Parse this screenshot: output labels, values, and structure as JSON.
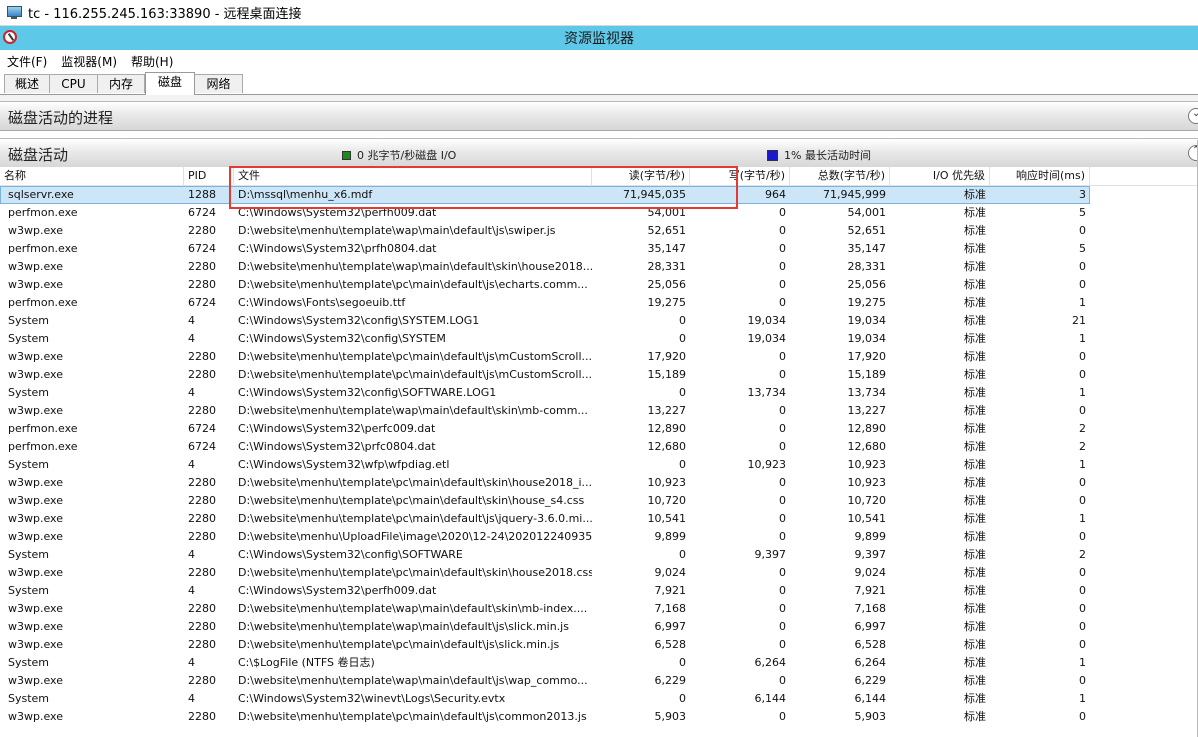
{
  "rdp": {
    "title": "tc - 116.255.245.163:33890 - 远程桌面连接"
  },
  "app": {
    "title": "资源监视器"
  },
  "menu": [
    "文件(F)",
    "监视器(M)",
    "帮助(H)"
  ],
  "tabs": [
    "概述",
    "CPU",
    "内存",
    "磁盘",
    "网络"
  ],
  "active_tab": "磁盘",
  "sections": {
    "processes": "磁盘活动的进程",
    "activity": "磁盘活动",
    "legend_io": "0 兆字节/秒磁盘 I/O",
    "legend_active": "1% 最长活动时间",
    "legend_io_color": "#1a8a1a",
    "legend_active_color": "#1a1acc"
  },
  "columns": [
    "名称",
    "PID",
    "文件",
    "读(字节/秒)",
    "写(字节/秒)",
    "总数(字节/秒)",
    "I/O 优先级",
    "响应时间(ms)"
  ],
  "rows": [
    [
      "sqlservr.exe",
      "1288",
      "D:\\mssql\\menhu_x6.mdf",
      "71,945,035",
      "964",
      "71,945,999",
      "标准",
      "3"
    ],
    [
      "perfmon.exe",
      "6724",
      "C:\\Windows\\System32\\perfh009.dat",
      "54,001",
      "0",
      "54,001",
      "标准",
      "5"
    ],
    [
      "w3wp.exe",
      "2280",
      "D:\\website\\menhu\\template\\wap\\main\\default\\js\\swiper.js",
      "52,651",
      "0",
      "52,651",
      "标准",
      "0"
    ],
    [
      "perfmon.exe",
      "6724",
      "C:\\Windows\\System32\\prfh0804.dat",
      "35,147",
      "0",
      "35,147",
      "标准",
      "5"
    ],
    [
      "w3wp.exe",
      "2280",
      "D:\\website\\menhu\\template\\wap\\main\\default\\skin\\house2018...",
      "28,331",
      "0",
      "28,331",
      "标准",
      "0"
    ],
    [
      "w3wp.exe",
      "2280",
      "D:\\website\\menhu\\template\\pc\\main\\default\\js\\echarts.comm...",
      "25,056",
      "0",
      "25,056",
      "标准",
      "0"
    ],
    [
      "perfmon.exe",
      "6724",
      "C:\\Windows\\Fonts\\segoeuib.ttf",
      "19,275",
      "0",
      "19,275",
      "标准",
      "1"
    ],
    [
      "System",
      "4",
      "C:\\Windows\\System32\\config\\SYSTEM.LOG1",
      "0",
      "19,034",
      "19,034",
      "标准",
      "21"
    ],
    [
      "System",
      "4",
      "C:\\Windows\\System32\\config\\SYSTEM",
      "0",
      "19,034",
      "19,034",
      "标准",
      "1"
    ],
    [
      "w3wp.exe",
      "2280",
      "D:\\website\\menhu\\template\\pc\\main\\default\\js\\mCustomScroll...",
      "17,920",
      "0",
      "17,920",
      "标准",
      "0"
    ],
    [
      "w3wp.exe",
      "2280",
      "D:\\website\\menhu\\template\\pc\\main\\default\\js\\mCustomScroll...",
      "15,189",
      "0",
      "15,189",
      "标准",
      "0"
    ],
    [
      "System",
      "4",
      "C:\\Windows\\System32\\config\\SOFTWARE.LOG1",
      "0",
      "13,734",
      "13,734",
      "标准",
      "1"
    ],
    [
      "w3wp.exe",
      "2280",
      "D:\\website\\menhu\\template\\wap\\main\\default\\skin\\mb-comm...",
      "13,227",
      "0",
      "13,227",
      "标准",
      "0"
    ],
    [
      "perfmon.exe",
      "6724",
      "C:\\Windows\\System32\\perfc009.dat",
      "12,890",
      "0",
      "12,890",
      "标准",
      "2"
    ],
    [
      "perfmon.exe",
      "6724",
      "C:\\Windows\\System32\\prfc0804.dat",
      "12,680",
      "0",
      "12,680",
      "标准",
      "2"
    ],
    [
      "System",
      "4",
      "C:\\Windows\\System32\\wfp\\wfpdiag.etl",
      "0",
      "10,923",
      "10,923",
      "标准",
      "1"
    ],
    [
      "w3wp.exe",
      "2280",
      "D:\\website\\menhu\\template\\pc\\main\\default\\skin\\house2018_i...",
      "10,923",
      "0",
      "10,923",
      "标准",
      "0"
    ],
    [
      "w3wp.exe",
      "2280",
      "D:\\website\\menhu\\template\\pc\\main\\default\\skin\\house_s4.css",
      "10,720",
      "0",
      "10,720",
      "标准",
      "0"
    ],
    [
      "w3wp.exe",
      "2280",
      "D:\\website\\menhu\\template\\pc\\main\\default\\js\\jquery-3.6.0.mi...",
      "10,541",
      "0",
      "10,541",
      "标准",
      "1"
    ],
    [
      "w3wp.exe",
      "2280",
      "D:\\website\\menhu\\UploadFile\\image\\2020\\12-24\\202012240935...",
      "9,899",
      "0",
      "9,899",
      "标准",
      "0"
    ],
    [
      "System",
      "4",
      "C:\\Windows\\System32\\config\\SOFTWARE",
      "0",
      "9,397",
      "9,397",
      "标准",
      "2"
    ],
    [
      "w3wp.exe",
      "2280",
      "D:\\website\\menhu\\template\\pc\\main\\default\\skin\\house2018.css",
      "9,024",
      "0",
      "9,024",
      "标准",
      "0"
    ],
    [
      "System",
      "4",
      "C:\\Windows\\System32\\perfh009.dat",
      "7,921",
      "0",
      "7,921",
      "标准",
      "0"
    ],
    [
      "w3wp.exe",
      "2280",
      "D:\\website\\menhu\\template\\wap\\main\\default\\skin\\mb-index....",
      "7,168",
      "0",
      "7,168",
      "标准",
      "0"
    ],
    [
      "w3wp.exe",
      "2280",
      "D:\\website\\menhu\\template\\wap\\main\\default\\js\\slick.min.js",
      "6,997",
      "0",
      "6,997",
      "标准",
      "0"
    ],
    [
      "w3wp.exe",
      "2280",
      "D:\\website\\menhu\\template\\pc\\main\\default\\js\\slick.min.js",
      "6,528",
      "0",
      "6,528",
      "标准",
      "0"
    ],
    [
      "System",
      "4",
      "C:\\$LogFile (NTFS 卷日志)",
      "0",
      "6,264",
      "6,264",
      "标准",
      "1"
    ],
    [
      "w3wp.exe",
      "2280",
      "D:\\website\\menhu\\template\\wap\\main\\default\\js\\wap_commo...",
      "6,229",
      "0",
      "6,229",
      "标准",
      "0"
    ],
    [
      "System",
      "4",
      "C:\\Windows\\System32\\winevt\\Logs\\Security.evtx",
      "0",
      "6,144",
      "6,144",
      "标准",
      "1"
    ],
    [
      "w3wp.exe",
      "2280",
      "D:\\website\\menhu\\template\\pc\\main\\default\\js\\common2013.js",
      "5,903",
      "0",
      "5,903",
      "标准",
      "0"
    ]
  ]
}
